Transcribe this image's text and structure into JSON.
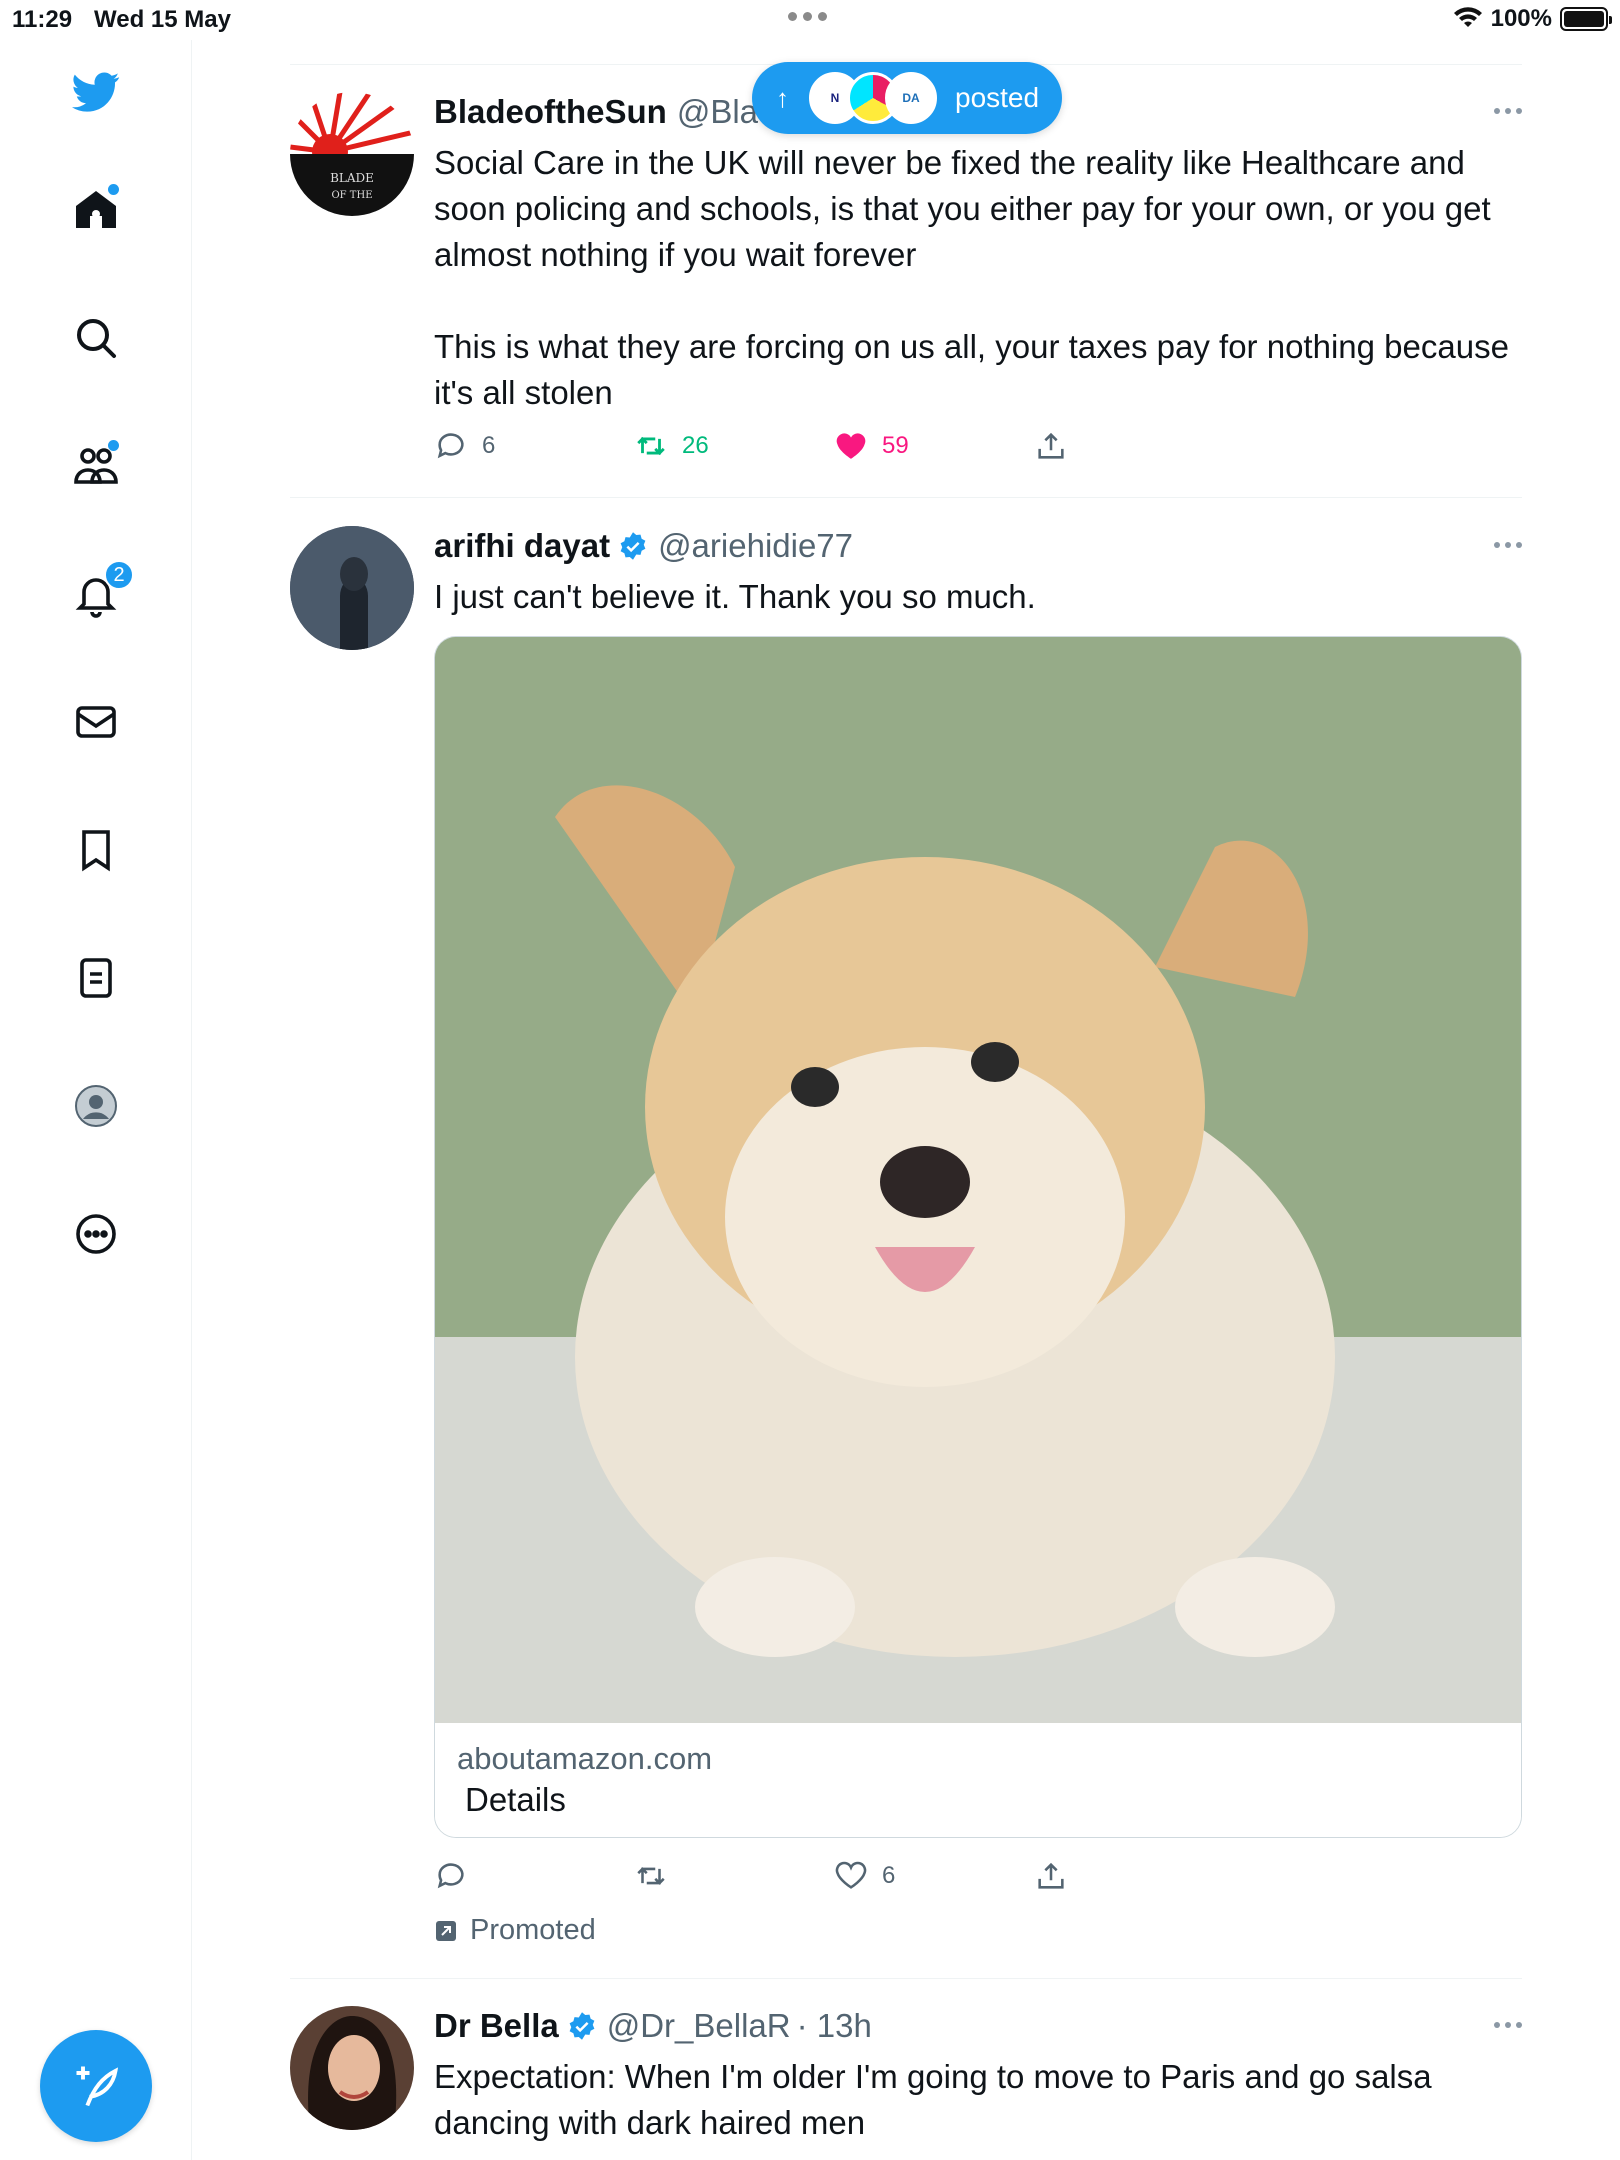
{
  "status_bar": {
    "time": "11:29",
    "date": "Wed 15 May",
    "battery": "100%",
    "battery_level": 1.0
  },
  "sidebar": {
    "items": [
      {
        "icon": "twitter-bird-icon"
      },
      {
        "icon": "home-icon",
        "has_dot": true
      },
      {
        "icon": "search-icon"
      },
      {
        "icon": "communities-icon",
        "has_dot": true
      },
      {
        "icon": "bell-icon",
        "badge": "2"
      },
      {
        "icon": "mail-icon"
      },
      {
        "icon": "bookmark-icon"
      },
      {
        "icon": "lists-icon"
      },
      {
        "icon": "profile-icon"
      },
      {
        "icon": "more-icon"
      }
    ],
    "compose": "compose-icon"
  },
  "pill": {
    "arrow": "↑",
    "label": "posted",
    "avatars": [
      "N",
      "",
      "DA"
    ]
  },
  "tweets": [
    {
      "name": "BladeoftheSun",
      "handle": "@Bla",
      "text": "Social Care in the UK will never be fixed the reality like Healthcare and soon policing and schools, is that you either pay for your own, or you get almost nothing if you wait forever\n\nThis is what they are forcing on us all, your taxes pay for nothing because it's all stolen",
      "replies": "6",
      "retweets": "26",
      "likes": "59",
      "avatar_text": "BLADE OF THE"
    },
    {
      "name": "arifhi dayat",
      "handle": "@ariehidie77",
      "text": "I just can't believe it. Thank you so much.",
      "card_domain": "aboutamazon.com",
      "card_title": "Details",
      "likes": "6",
      "promoted": "Promoted"
    },
    {
      "name": "Dr Bella",
      "handle": "@Dr_BellaR",
      "time": "· 13h",
      "text": "Expectation: When I'm older I'm going to move to Paris and go salsa dancing with dark haired men"
    }
  ],
  "colors": {
    "accent": "#1d9bf0",
    "like": "#f91880",
    "retweet": "#00ba7c"
  }
}
